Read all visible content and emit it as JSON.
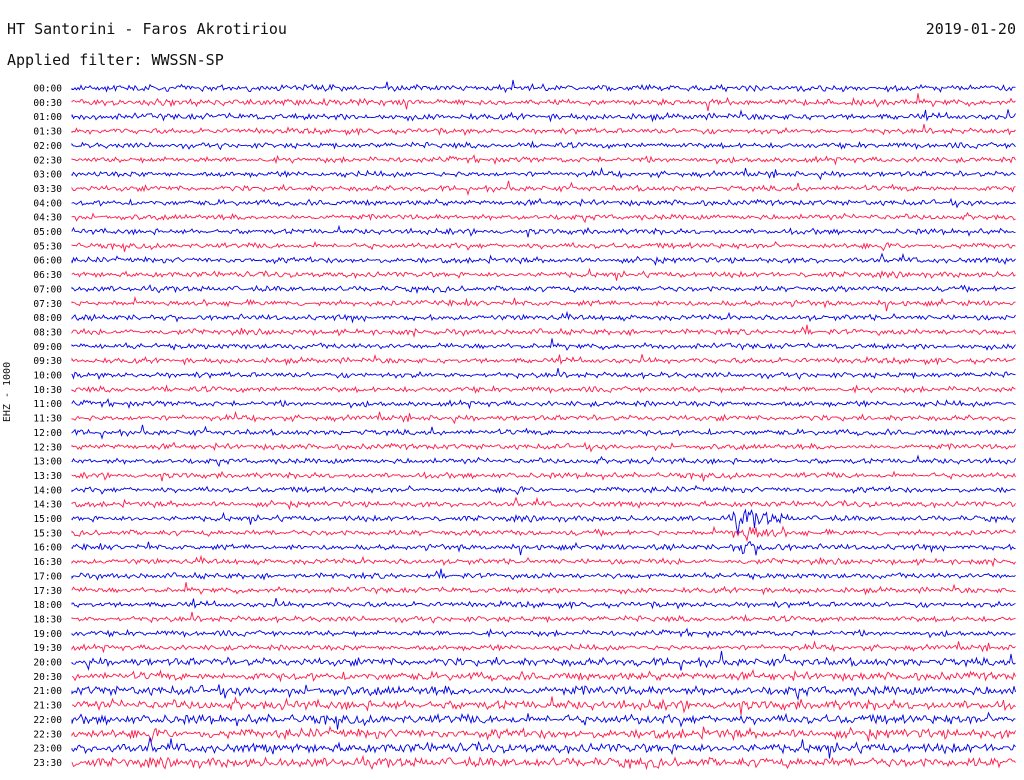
{
  "header": {
    "station": "HT Santorini - Faros Akrotiriou",
    "date": "2019-01-20",
    "filter_label": "Applied filter:",
    "filter_value": "WWSSN-SP",
    "channel": "EHZ - 1000"
  },
  "colors": {
    "trace_a": "#0000e6",
    "trace_b": "#ff1a4a",
    "background": "#ffffff"
  },
  "chart_data": {
    "type": "line",
    "row_labels": [
      "00:00",
      "00:30",
      "01:00",
      "01:30",
      "02:00",
      "02:30",
      "03:00",
      "03:30",
      "04:00",
      "04:30",
      "05:00",
      "05:30",
      "06:00",
      "06:30",
      "07:00",
      "07:30",
      "08:00",
      "08:30",
      "09:00",
      "09:30",
      "10:00",
      "10:30",
      "11:00",
      "11:30",
      "12:00",
      "12:30",
      "13:00",
      "13:30",
      "14:00",
      "14:30",
      "15:00",
      "15:30",
      "16:00",
      "16:30",
      "17:00",
      "17:30",
      "18:00",
      "18:30",
      "19:00",
      "19:30",
      "20:00",
      "20:30",
      "21:00",
      "21:30",
      "22:00",
      "22:30",
      "23:00",
      "23:30"
    ],
    "row_minutes": 30,
    "event": {
      "row_label": "15:00",
      "position_fraction": 0.7
    }
  }
}
